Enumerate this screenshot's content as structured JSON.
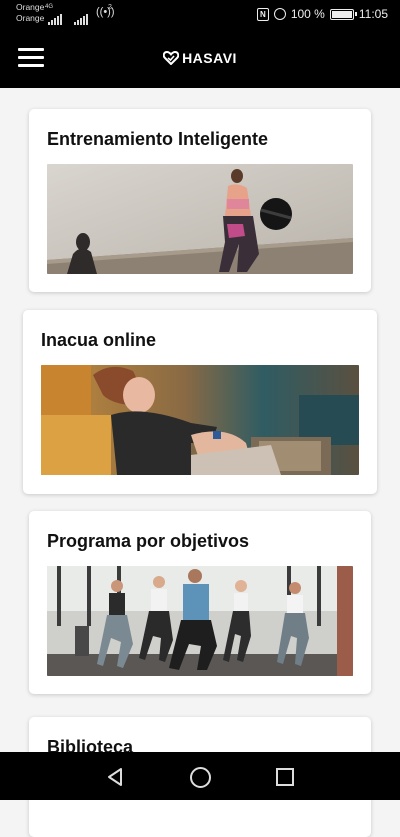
{
  "status_bar": {
    "carrier_1": "Orange",
    "carrier_2": "Orange",
    "network_type": "4G",
    "hotspot_badge": "2",
    "battery_percent": "100 %",
    "time": "11:05"
  },
  "app_bar": {
    "brand": "HASAVI",
    "menu_icon": "hamburger-menu-icon",
    "logo_icon": "heart-logo-icon"
  },
  "cards": [
    {
      "title": "Entrenamiento Inteligente",
      "image": "woman-with-medicine-ball"
    },
    {
      "title": "Inacua online",
      "image": "woman-stretching-at-home"
    },
    {
      "title": "Programa por objetivos",
      "image": "group-doing-lunges"
    },
    {
      "title": "Biblioteca",
      "image": ""
    }
  ],
  "nav_bar": {
    "back_icon": "back-triangle-icon",
    "home_icon": "home-circle-icon",
    "recents_icon": "recents-square-icon"
  }
}
